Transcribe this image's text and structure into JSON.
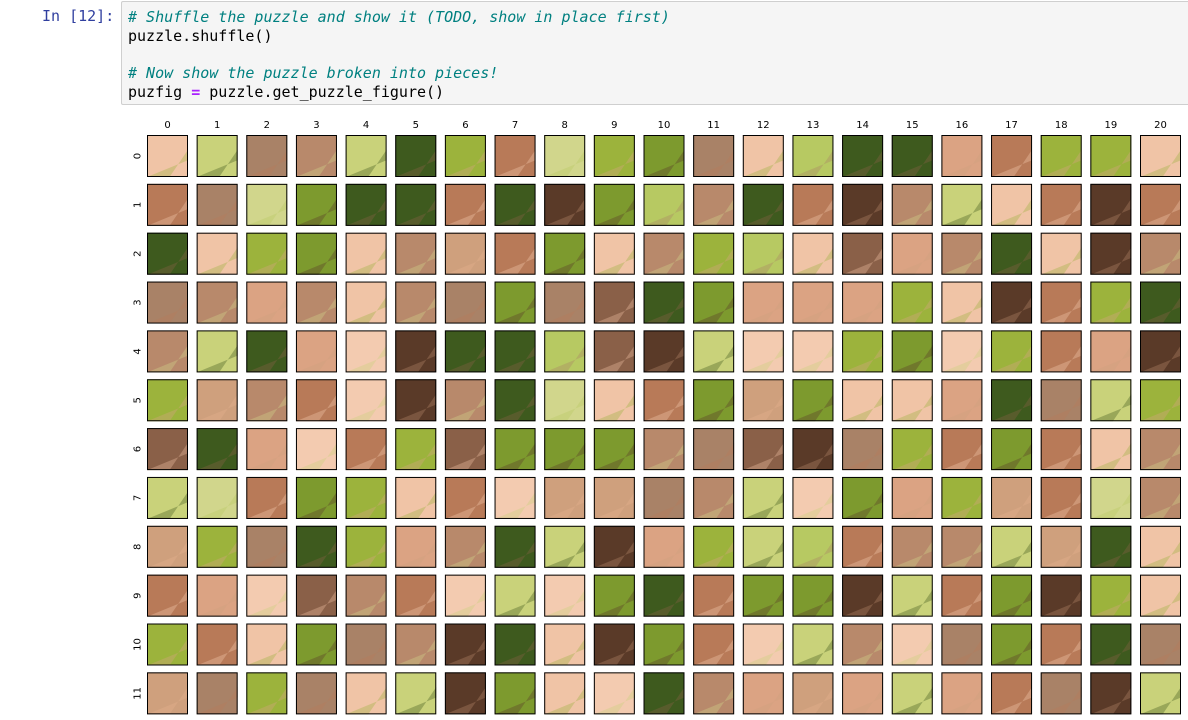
{
  "cell": {
    "prompt": "In [12]:",
    "lines": [
      {
        "comment": "# Shuffle the puzzle and show it (TODO, show in place first)"
      },
      {
        "code": "puzzle.shuffle()"
      },
      {
        "code": ""
      },
      {
        "comment": "# Now show the puzzle broken into pieces!"
      },
      {
        "pre": "puzfig ",
        "op": "=",
        "post": " puzzle.get_puzzle_figure()"
      }
    ]
  },
  "figure": {
    "col_labels": [
      "0",
      "1",
      "2",
      "3",
      "4",
      "5",
      "6",
      "7",
      "8",
      "9",
      "10",
      "11",
      "12",
      "13",
      "14",
      "15",
      "16",
      "17",
      "18",
      "19",
      "20"
    ],
    "row_labels": [
      "0",
      "1",
      "2",
      "3",
      "4",
      "5",
      "6",
      "7",
      "8",
      "9",
      "10",
      "11"
    ],
    "colors": {
      "palette": [
        "#f0c4a6",
        "#c9d27a",
        "#a98267",
        "#b8896b",
        "#e6b18f",
        "#9cb33c",
        "#3e5a1e",
        "#b87a58",
        "#d1d68c",
        "#7d9a2e",
        "#dba383",
        "#8a6048",
        "#f3cbb0",
        "#b7c962",
        "#5a3a28",
        "#cfa07d"
      ],
      "grid": [
        [
          0,
          1,
          2,
          3,
          1,
          6,
          5,
          7,
          8,
          5,
          9,
          2,
          0,
          13,
          6,
          6,
          10,
          7,
          5,
          5,
          0
        ],
        [
          7,
          2,
          8,
          9,
          6,
          6,
          7,
          6,
          14,
          9,
          13,
          3,
          6,
          7,
          14,
          3,
          1,
          0,
          7,
          14,
          7
        ],
        [
          6,
          0,
          5,
          9,
          0,
          3,
          15,
          7,
          9,
          0,
          3,
          5,
          13,
          0,
          11,
          10,
          3,
          6,
          0,
          14,
          3
        ],
        [
          2,
          3,
          10,
          3,
          0,
          3,
          2,
          9,
          2,
          11,
          6,
          9,
          10,
          10,
          10,
          5,
          0,
          14,
          7,
          5,
          6
        ],
        [
          3,
          1,
          6,
          10,
          12,
          14,
          6,
          6,
          13,
          11,
          14,
          1,
          12,
          12,
          5,
          9,
          12,
          5,
          7,
          10,
          14
        ],
        [
          5,
          15,
          3,
          7,
          12,
          14,
          3,
          6,
          8,
          0,
          7,
          9,
          15,
          9,
          0,
          0,
          10,
          6,
          2,
          1,
          5
        ],
        [
          11,
          6,
          10,
          12,
          7,
          5,
          11,
          9,
          9,
          9,
          3,
          2,
          11,
          14,
          2,
          5,
          7,
          9,
          7,
          0,
          3
        ],
        [
          1,
          8,
          7,
          9,
          5,
          0,
          7,
          12,
          15,
          15,
          2,
          3,
          1,
          12,
          9,
          10,
          5,
          15,
          7,
          8,
          3
        ],
        [
          15,
          5,
          2,
          6,
          5,
          10,
          3,
          6,
          1,
          14,
          10,
          5,
          1,
          13,
          7,
          3,
          3,
          1,
          15,
          6,
          0
        ],
        [
          7,
          10,
          12,
          11,
          3,
          7,
          12,
          1,
          12,
          9,
          6,
          7,
          9,
          9,
          14,
          1,
          7,
          9,
          14,
          5,
          0
        ],
        [
          5,
          7,
          0,
          9,
          2,
          3,
          14,
          6,
          0,
          14,
          9,
          7,
          12,
          1,
          3,
          12,
          2,
          9,
          7,
          6,
          2
        ],
        [
          15,
          2,
          5,
          2,
          0,
          1,
          14,
          9,
          0,
          12,
          6,
          3,
          10,
          15,
          10,
          1,
          10,
          7,
          2,
          14,
          1
        ]
      ]
    }
  }
}
